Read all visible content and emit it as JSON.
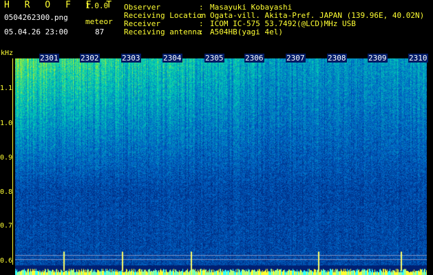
{
  "header": {
    "app_title": "H R O F F T",
    "app_version": "1.0.0",
    "file_name": "0504262300.png",
    "mode_label": "meteor",
    "timestamp": "05.04.26 23:00",
    "count": "87"
  },
  "info": [
    {
      "key": "Observer",
      "value": "Masayuki Kobayashi"
    },
    {
      "key": "Receiving Location",
      "value": "Ogata-vill. Akita-Pref. JAPAN (139.96E, 40.02N)"
    },
    {
      "key": "Receiver",
      "value": "ICOM IC-575 53.7492(@LCD)MHz USB"
    },
    {
      "key": "Receiving antenna",
      "value": "A504HB(yagi 4el)"
    }
  ],
  "separator": ":",
  "y_axis": {
    "unit": "kHz",
    "ticks": [
      "1.1",
      "1.0",
      "0.9",
      "0.8",
      "0.7",
      "0.6"
    ]
  },
  "x_axis": {
    "ticks": [
      "2301",
      "2302",
      "2303",
      "2304",
      "2305",
      "2306",
      "2307",
      "2308",
      "2309",
      "2310"
    ]
  },
  "colors": {
    "label_yellow": "#ffff33",
    "background": "#000000",
    "spectrum_low": "#001a66",
    "spectrum_mid": "#00a0d0",
    "spectrum_high": "#c8e020"
  }
}
